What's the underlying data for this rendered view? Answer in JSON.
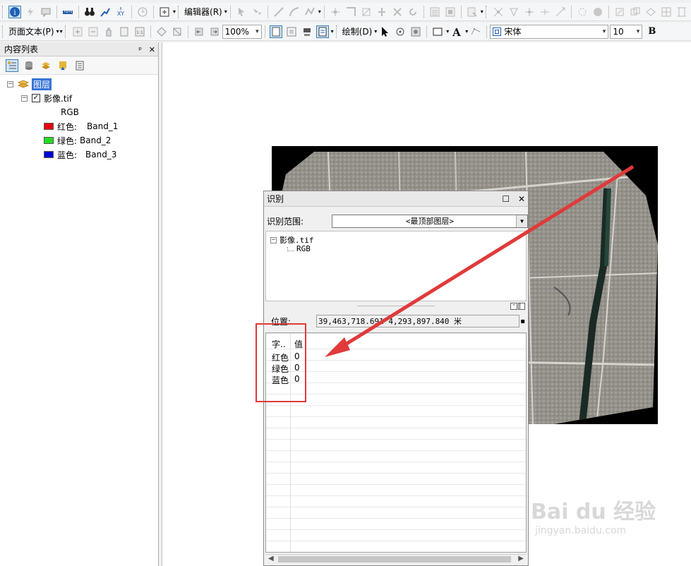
{
  "toolbar1": {
    "editor_menu": "编辑器(R)"
  },
  "toolbar2": {
    "layout_text_menu": "页面文本(P)",
    "zoom_value": "100%",
    "draw_menu": "绘制(D)",
    "font_name": "宋体",
    "font_size": "10",
    "bold_label": "B"
  },
  "toc": {
    "title": "内容列表",
    "pin_label": "ᵖ",
    "close_label": "✕",
    "root_label": "图层",
    "layer_name": "影像.tif",
    "renderer_label": "RGB",
    "bands": [
      {
        "channel": "红色:",
        "band": "Band_1",
        "color": "#e8000e"
      },
      {
        "channel": "绿色:",
        "band": "Band_2",
        "color": "#22dd22"
      },
      {
        "channel": "蓝色:",
        "band": "Band_3",
        "color": "#0000d8"
      }
    ]
  },
  "identify": {
    "title": "识别",
    "scope_label": "识别范围:",
    "scope_value": "<最顶部图层>",
    "tree_layer": "影像.tif",
    "tree_child": "RGB",
    "location_label": "位置:",
    "location_value": "39,463,718.691  4,293,897.840 米",
    "table_header_field": "字..",
    "table_header_value": "值",
    "rows": [
      {
        "field": "红色",
        "value": "0"
      },
      {
        "field": "绿色",
        "value": "0"
      },
      {
        "field": "蓝色",
        "value": "0"
      }
    ]
  },
  "watermark": {
    "main": "Bai du 经验",
    "sub": "jingyan.baidu.com"
  },
  "colors": {
    "annotation_red": "#e03a3a",
    "selection_blue": "#3875d7"
  }
}
